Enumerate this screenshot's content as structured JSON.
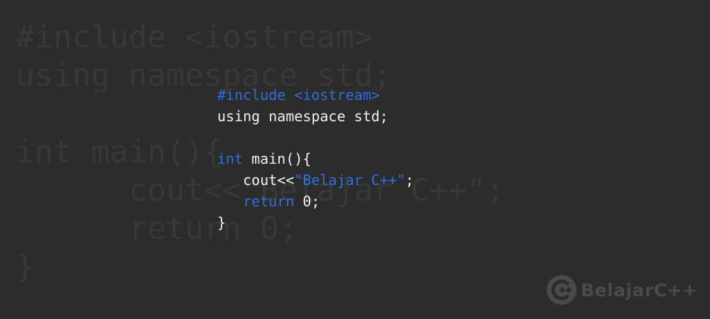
{
  "background_code": {
    "lines": [
      "#include <iostream>",
      "using namespace std;",
      "",
      "int main(){",
      "      cout<<\"Belajar C++\";",
      "      return 0;",
      "}"
    ]
  },
  "code": {
    "line1": {
      "directive": "#include <iostream>"
    },
    "line2": {
      "text": "using namespace std;"
    },
    "line4": {
      "keyword": "int",
      "rest": " main(){"
    },
    "line5": {
      "indent": "   ",
      "prefix": "cout<<",
      "string": "\"Belajar C++\"",
      "suffix": ";"
    },
    "line6": {
      "indent": "   ",
      "keyword": "return",
      "rest": " 0;"
    },
    "line7": {
      "text": "}"
    }
  },
  "logo": {
    "text": "BelajarC++",
    "icon": "c-plus-plus-logo-icon"
  },
  "colors": {
    "background": "#2c2c2c",
    "keyword": "#2f6fdc",
    "text": "#f0f0f0",
    "faded": "#383838",
    "logo": "#4a4a4a"
  }
}
